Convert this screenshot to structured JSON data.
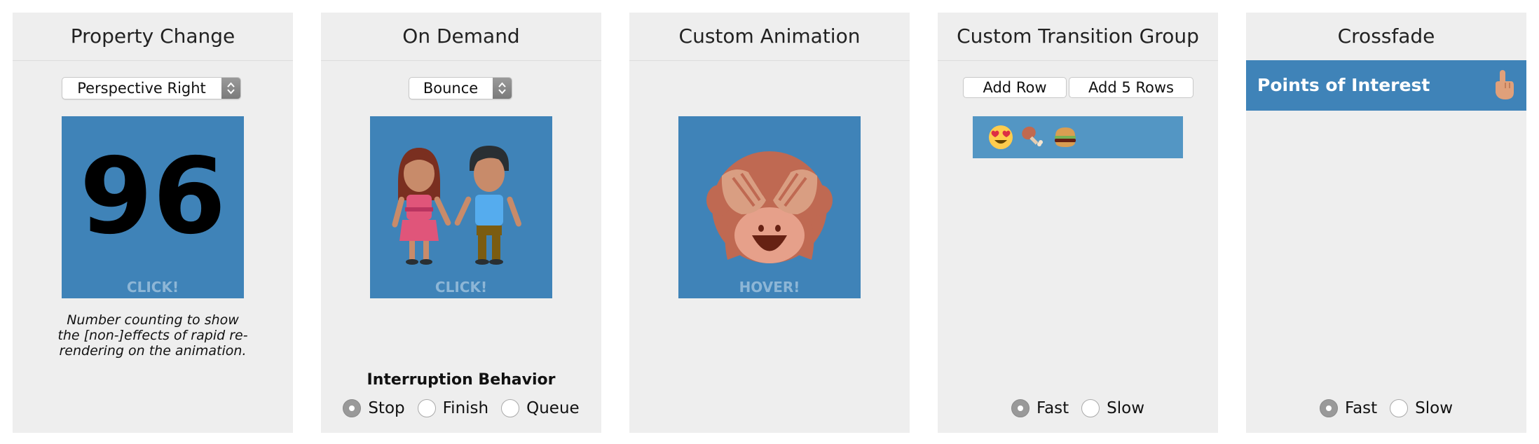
{
  "panels": [
    {
      "title": "Property Change",
      "select_value": "Perspective Right",
      "number": "96",
      "tile_caption": "CLICK!",
      "note": "Number counting to show the [non-]effects of rapid re-rendering on the animation."
    },
    {
      "title": "On Demand",
      "select_value": "Bounce",
      "tile_icon": "couple-holding-hands-icon",
      "tile_caption": "CLICK!",
      "interruption_label": "Interruption Behavior",
      "options": [
        "Stop",
        "Finish",
        "Queue"
      ],
      "selected": "Stop"
    },
    {
      "title": "Custom Animation",
      "tile_icon": "see-no-evil-monkey-icon",
      "tile_caption": "HOVER!"
    },
    {
      "title": "Custom Transition Group",
      "add_row_label": "Add Row",
      "add_5_rows_label": "Add 5 Rows",
      "row_items": [
        "heart-eyes-emoji",
        "poultry-leg-emoji",
        "hamburger-emoji"
      ],
      "options": [
        "Fast",
        "Slow"
      ],
      "selected": "Fast"
    },
    {
      "title": "Crossfade",
      "item_label": "Points of Interest",
      "item_icon": "pointing-hand-icon",
      "options": [
        "Fast",
        "Slow"
      ],
      "selected": "Fast"
    }
  ],
  "colors": {
    "panel_bg": "#eeeeee",
    "tile_blue": "#3f83b8",
    "row_blue": "#5396c4",
    "caption": "#8db6d6"
  }
}
